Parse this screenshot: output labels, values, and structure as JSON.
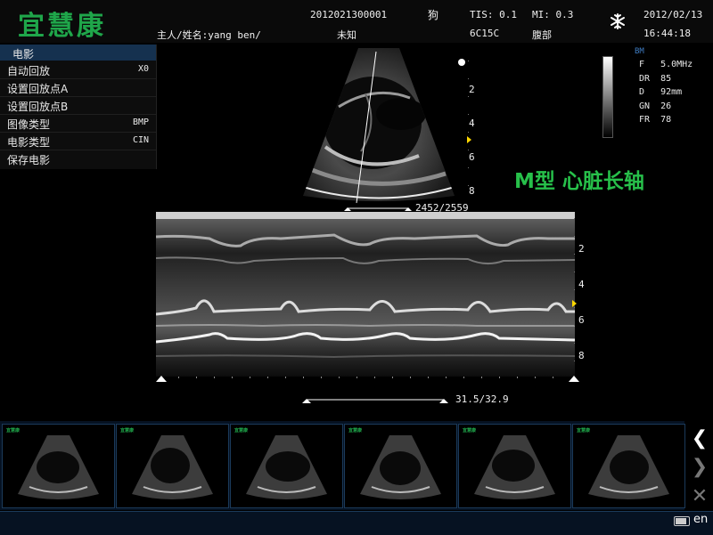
{
  "header": {
    "logo_text": "宜慧康",
    "owner_label": "主人/姓名:yang ben/",
    "exam_id": "2012021300001",
    "species": "狗",
    "breed": "未知",
    "tis": "TIS: 0.1",
    "mi": "MI: 0.3",
    "probe": "6C15C",
    "region": "腹部",
    "date": "2012/02/13",
    "time": "16:44:18",
    "freeze_icon": "snowflake-icon"
  },
  "menu": {
    "title": "电影",
    "items": [
      {
        "label": "自动回放",
        "value": "X0"
      },
      {
        "label": "设置回放点A",
        "value": ""
      },
      {
        "label": "设置回放点B",
        "value": ""
      },
      {
        "label": "图像类型",
        "value": "BMP"
      },
      {
        "label": "电影类型",
        "value": "CIN"
      },
      {
        "label": "保存电影",
        "value": ""
      }
    ]
  },
  "params": {
    "mode": "BM",
    "items": [
      "F   5.0MHz",
      "DR  85",
      "D   92mm",
      "GN  26",
      "FR  78"
    ]
  },
  "mode_label": "M型 心脏长轴",
  "b_mode": {
    "depth_ticks": [
      "2",
      "4",
      "6",
      "8"
    ],
    "frame_counter": "2452/2559"
  },
  "m_mode": {
    "depth_ticks": [
      "2",
      "4",
      "6",
      "8"
    ],
    "time_counter": "31.5/32.9"
  },
  "thumbnails": {
    "count": 6,
    "logo_text": "宜慧康"
  },
  "nav": {
    "prev": "❮",
    "next": "❯",
    "close": "✕"
  },
  "status": {
    "language": "en",
    "battery_icon": "battery-icon"
  },
  "colors": {
    "brand_green": "#1fa64a",
    "mode_label_green": "#27c04a",
    "menu_title_bg": "#15314f",
    "marker_yellow": "#ffd700"
  }
}
